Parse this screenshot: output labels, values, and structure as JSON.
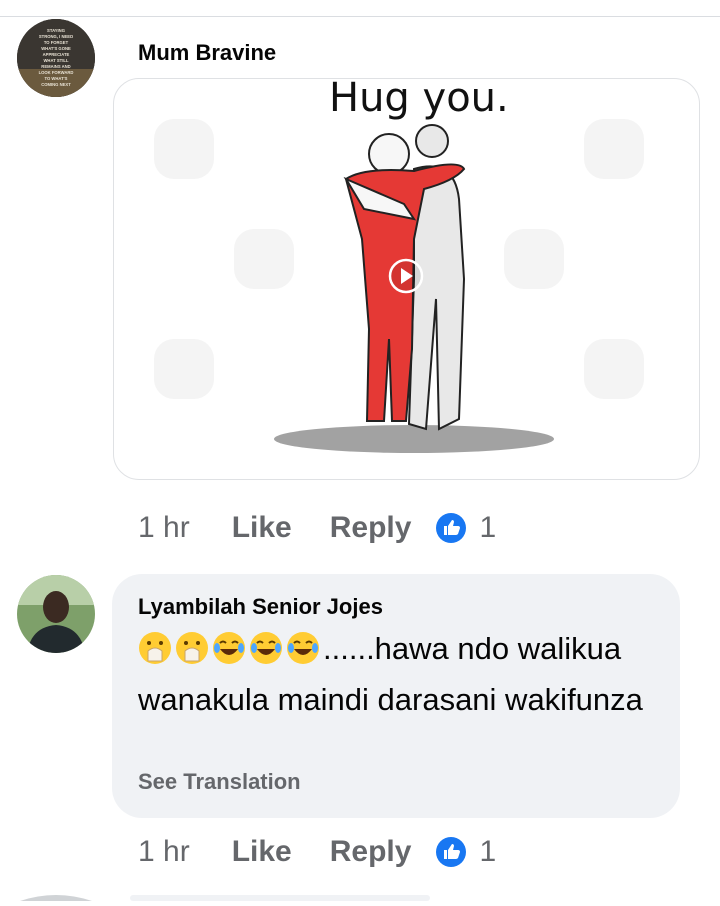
{
  "comments": [
    {
      "author": "Mum Bravine",
      "sticker_caption": "Hug you.",
      "time": "1 hr",
      "like_label": "Like",
      "reply_label": "Reply",
      "reaction_count": "1",
      "avatar_text": "STAYING STRONG, I NEED TO FORGET WHAT'S GONE, APPRECIATE WHAT STILL REMAINS AND LOOK FORWARD TO WHAT'S COMING NEXT"
    },
    {
      "author": "Lyambilah Senior Jojes",
      "emojis": [
        "hand-over-mouth-emoji",
        "hand-over-mouth-emoji",
        "tears-of-joy-emoji",
        "tears-of-joy-emoji",
        "tears-of-joy-emoji"
      ],
      "text": "......hawa ndo walikua wanakula maindi darasani wakifunza",
      "see_translation": "See Translation",
      "time": "1 hr",
      "like_label": "Like",
      "reply_label": "Reply",
      "reaction_count": "1"
    }
  ],
  "colors": {
    "like_blue": "#1877f2",
    "meta_gray": "#65676b",
    "bubble_bg": "#f0f2f5",
    "hug_red": "#e53935"
  }
}
